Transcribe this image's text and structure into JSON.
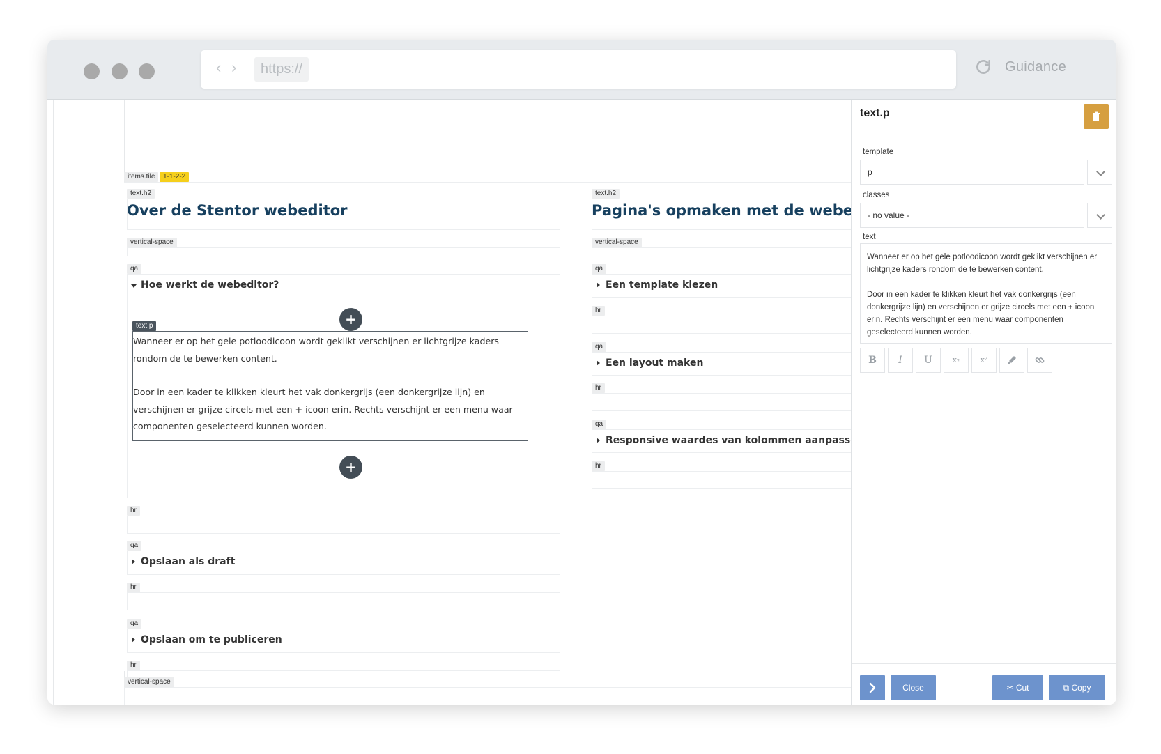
{
  "browser": {
    "url": "https://",
    "brand": "Guidance",
    "back_glyph": "‹",
    "forward_glyph": "›"
  },
  "tile": {
    "tag": "items.tile",
    "id_badge": "1-1-2-2"
  },
  "left": {
    "heading_tag": "text.h2",
    "heading": "Over de Stentor webeditor",
    "vspace_tag": "vertical-space",
    "qa_tag": "qa",
    "qa_open_title": "Hoe werkt de webeditor?",
    "textp_tag": "text.p",
    "textp_para1": "Wanneer er op het gele potloodicoon wordt geklikt verschijnen er lichtgrijze kaders rondom de te bewerken content.",
    "textp_para2": "Door in een kader te klikken kleurt het vak donkergrijs (een donkergrijze lijn) en verschijnen er grijze circels met een + icoon erin. Rechts verschijnt er een menu waar componenten geselecteerd kunnen worden.",
    "plus_glyph": "+",
    "hr_tag": "hr",
    "qa2_title": "Opslaan als draft",
    "qa3_title": "Opslaan om te publiceren"
  },
  "right": {
    "heading_tag": "text.h2",
    "heading": "Pagina's opmaken met de webeditor",
    "vspace_tag": "vertical-space",
    "qa_tag": "qa",
    "hr_tag": "hr",
    "qa1_title": "Een template kiezen",
    "qa2_title": "Een layout maken",
    "qa3_title": "Responsive waardes van kolommen aanpassen"
  },
  "bottom_vspace_tag": "vertical-space",
  "panel": {
    "title": "text.p",
    "template_label": "template",
    "template_value": "p",
    "classes_label": "classes",
    "classes_value": "- no value -",
    "text_label": "text",
    "text_para1": "Wanneer er op het gele potloodicoon wordt geklikt verschijnen er lichtgrijze kaders rondom de te bewerken content.",
    "text_para2": "Door in een kader te klikken kleurt het vak donkergrijs (een donkergrijze lijn) en verschijnen er grijze circels met een + icoon erin. Rechts verschijnt er een menu waar componenten geselecteerd kunnen worden.",
    "format_buttons": {
      "bold": "B",
      "italic": "I",
      "underline": "U",
      "subscript": "x₂",
      "superscript": "x²"
    },
    "close_label": "Close",
    "cut_label": "Cut",
    "copy_label": "Copy"
  },
  "colors": {
    "accent_blue": "#6d93cd",
    "heading_navy": "#17405f",
    "delete_orange": "#d69f40",
    "badge_yellow": "#f5cf1c",
    "plus_dark": "#434d56"
  }
}
